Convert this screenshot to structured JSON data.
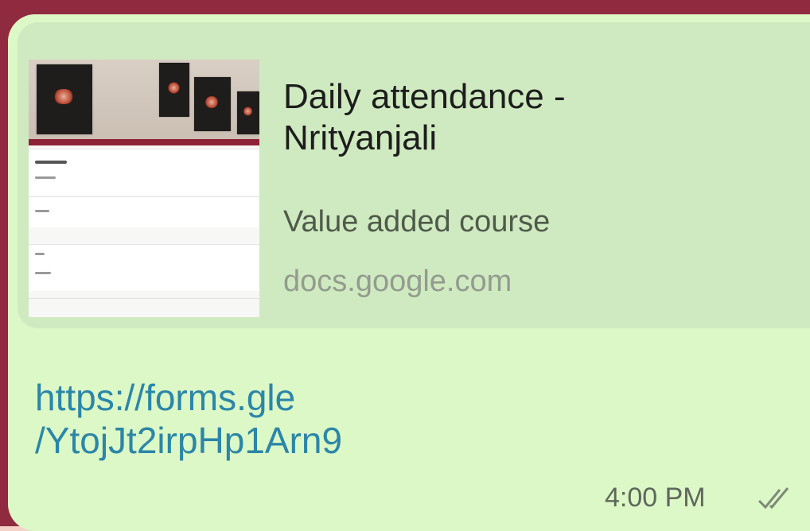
{
  "message": {
    "preview": {
      "title_line1": "Daily attendance -",
      "title_line2": "Nrityanjali",
      "description": "Value added course",
      "domain": "docs.google.com",
      "thumbnail_icon": "google-form-thumbnail"
    },
    "link_line1": "https://forms.gle",
    "link_line2": "/YtojJt2irpHp1Arn9",
    "time": "4:00 PM",
    "status_icon": "double-check-icon"
  },
  "colors": {
    "outer_background": "#f4d2c8",
    "frame": "#8f2a3f",
    "bubble": "#dcf8c6",
    "preview_card": "#cfeac0",
    "link": "#2b86a8",
    "thumbnail_stripe": "#8e2236"
  }
}
